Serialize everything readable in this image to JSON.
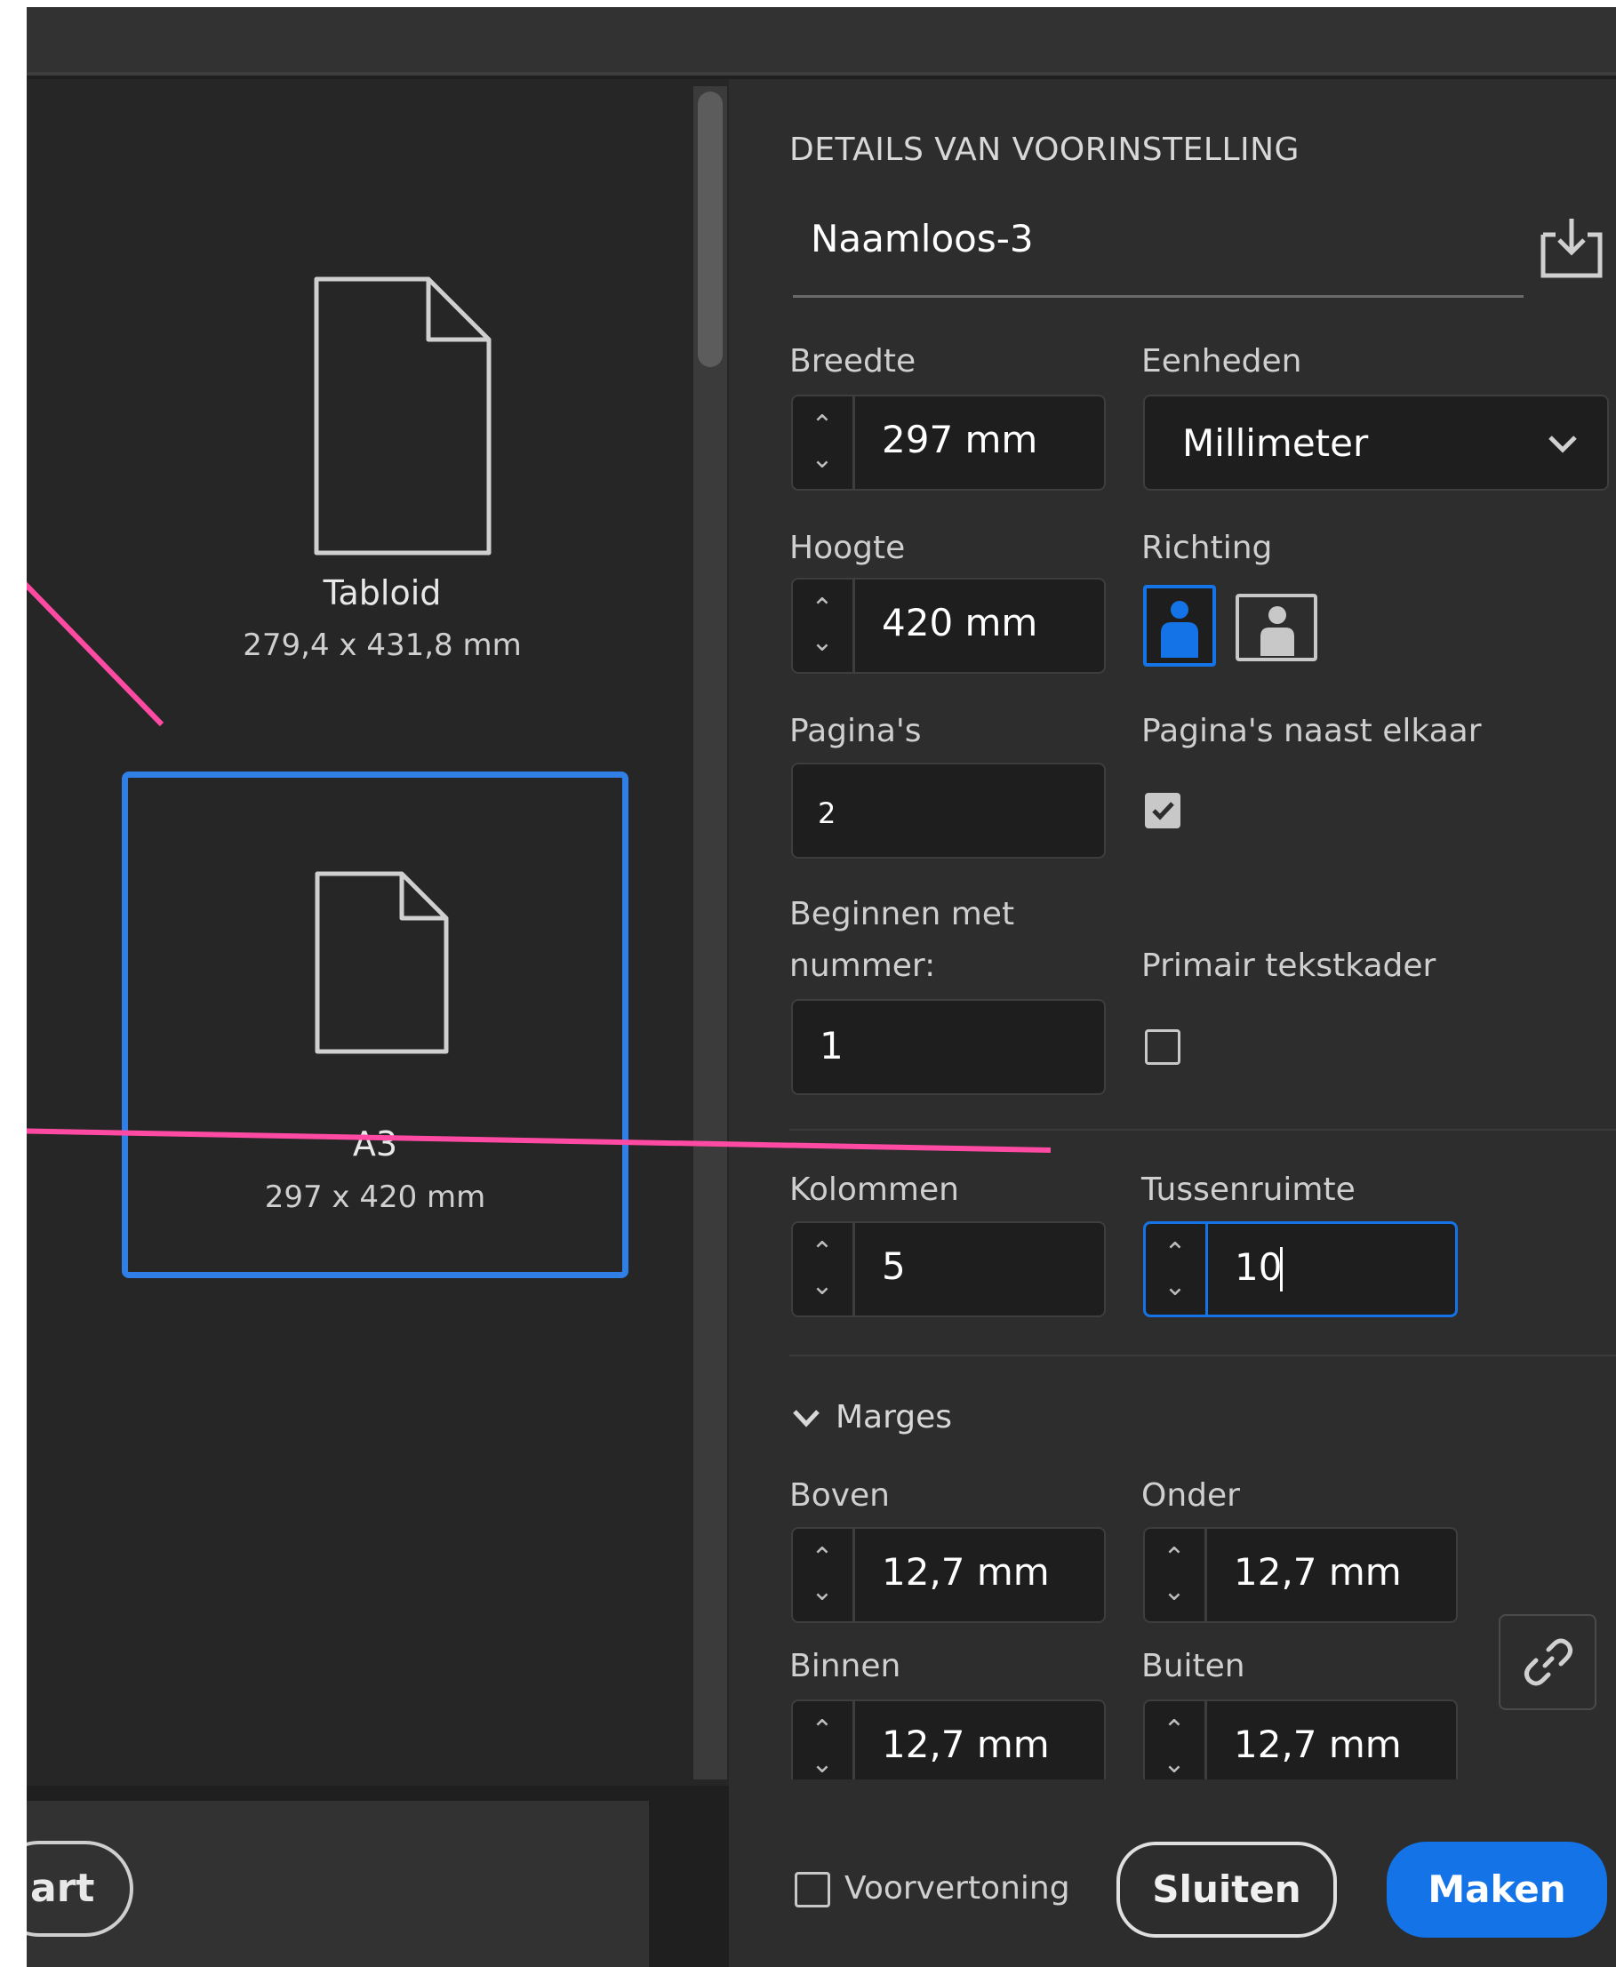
{
  "presets": [
    {
      "label": "Tabloid",
      "dims": "279,4 x 431,8 mm"
    },
    {
      "label": "A3",
      "dims": "297 x 420 mm"
    }
  ],
  "footer_left": {
    "button_fragment": "art"
  },
  "details": {
    "section_title": "DETAILS VAN VOORINSTELLING",
    "doc_name": "Naamloos-3",
    "width_label": "Breedte",
    "width_value": "297 mm",
    "units_label": "Eenheden",
    "units_value": "Millimeter",
    "height_label": "Hoogte",
    "height_value": "420 mm",
    "orientation_label": "Richting",
    "pages_label": "Pagina's",
    "pages_value": "2",
    "facing_label": "Pagina's naast elkaar",
    "start_label_line1": "Beginnen met",
    "start_label_line2": "nummer:",
    "start_value": "1",
    "primary_frame_label": "Primair tekstkader",
    "columns_label": "Kolommen",
    "columns_value": "5",
    "gutter_label": "Tussenruimte",
    "gutter_value": "10",
    "margins_title": "Marges",
    "top_label": "Boven",
    "top_value": "12,7 mm",
    "bottom_label": "Onder",
    "bottom_value": "12,7 mm",
    "inside_label": "Binnen",
    "inside_value": "12,7 mm",
    "outside_label": "Buiten",
    "outside_value": "12,7 mm"
  },
  "footer": {
    "preview_label": "Voorvertoning",
    "close_label": "Sluiten",
    "create_label": "Maken"
  },
  "colors": {
    "accent": "#1473e6",
    "annotation": "#ff4aa3"
  }
}
